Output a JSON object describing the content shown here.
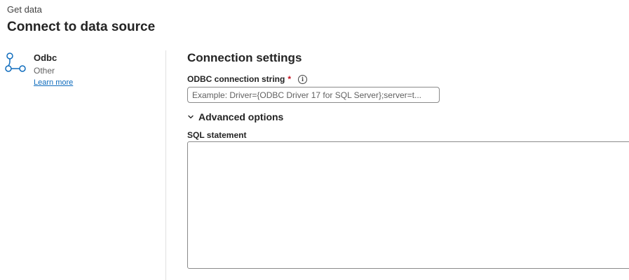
{
  "header": {
    "subtitle": "Get data",
    "title": "Connect to data source"
  },
  "connector": {
    "name": "Odbc",
    "category": "Other",
    "learn_more": "Learn more",
    "icon": "odbc-connector-icon"
  },
  "settings": {
    "section_title": "Connection settings",
    "connection_string": {
      "label": "ODBC connection string",
      "required_mark": "*",
      "info_icon": "ⓘ",
      "value": "",
      "placeholder": "Example: Driver={ODBC Driver 17 for SQL Server};server=t..."
    },
    "advanced_options": {
      "label": "Advanced options",
      "expanded": true
    },
    "sql_statement": {
      "label": "SQL statement",
      "value": ""
    }
  },
  "colors": {
    "link": "#0f6cbd",
    "required": "#c50f1f",
    "icon_stroke": "#0f6cbd"
  }
}
